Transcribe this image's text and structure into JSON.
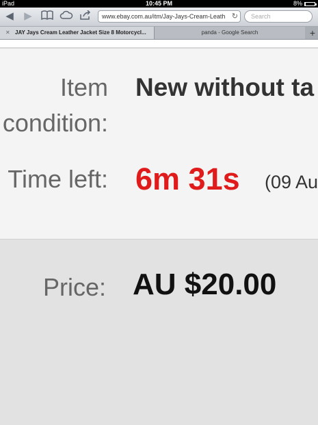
{
  "status_bar": {
    "device": "iPad",
    "time": "10:45 PM",
    "battery": "8%",
    "battery_level": 0.08
  },
  "toolbar": {
    "url": "www.ebay.com.au/itm/Jay-Jays-Cream-Leath",
    "search_placeholder": "Search"
  },
  "tabs": [
    {
      "label": "JAY Jays Cream Leather Jacket Size 8 Motorcycl..."
    },
    {
      "label": "panda - Google Search"
    }
  ],
  "listing": {
    "condition_label_1": "Item",
    "condition_label_2": "condition:",
    "condition_value": "New without ta",
    "time_left_label": "Time left:",
    "time_left_value": "6m 31s",
    "time_left_extra": "(09 Au",
    "price_label": "Price:",
    "price_value": "AU $20.00"
  },
  "colors": {
    "urgent": "#e01b1b",
    "label": "#666666",
    "value": "#222222"
  }
}
